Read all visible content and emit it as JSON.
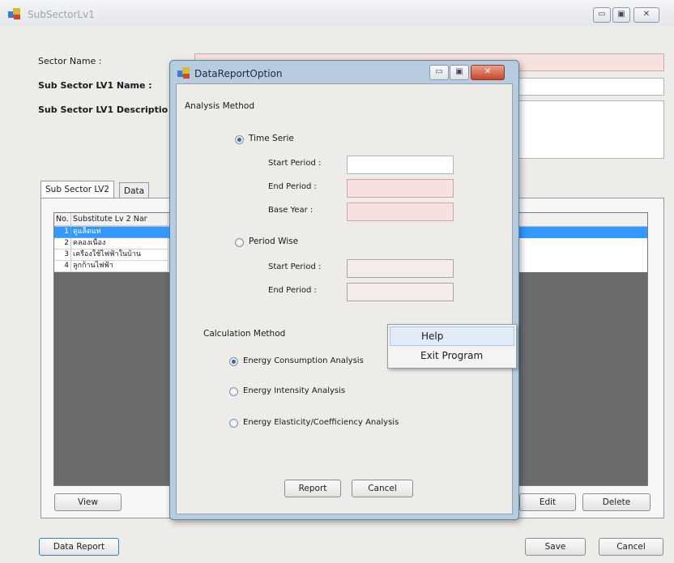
{
  "main_window": {
    "title": "SubSectorLv1",
    "controls": {
      "minimize": "▭",
      "maximize": "▣",
      "close": "✕"
    },
    "form": {
      "sector_name_label": "Sector Name :",
      "sub_sector_name_label": "Sub Sector LV1 Name :",
      "sub_sector_description_label": "Sub Sector LV1 Descriptio"
    },
    "tabs": [
      {
        "label": "Sub Sector LV2"
      },
      {
        "label": "Data"
      }
    ],
    "grid": {
      "headers": [
        "No.",
        "Substitute Lv 2 Nar"
      ],
      "rows": [
        {
          "no": "1",
          "name": "ดูแล็ดแท่"
        },
        {
          "no": "2",
          "name": "คลองเนื้อง"
        },
        {
          "no": "3",
          "name": "เครื่องใช้ไฟฟ้าในบ้าน"
        },
        {
          "no": "4",
          "name": "ลูกก้านไฟฟ้า"
        }
      ]
    },
    "buttons": {
      "view": "View",
      "edit": "Edit",
      "delete": "Delete",
      "data_report": "Data Report",
      "save": "Save",
      "cancel": "Cancel"
    }
  },
  "dialog": {
    "title": "DataReportOption",
    "controls": {
      "minimize": "▭",
      "maximize": "▣",
      "close": "✕"
    },
    "analysis_method": {
      "label": "Analysis Method",
      "time_serie": {
        "label": "Time Serie",
        "selected": true,
        "start_period_label": "Start Period :",
        "end_period_label": "End Period :",
        "base_year_label": "Base Year :"
      },
      "period_wise": {
        "label": "Period Wise",
        "selected": false,
        "start_period_label": "Start Period :",
        "end_period_label": "End Period :"
      }
    },
    "calculation_method": {
      "label": "Calculation Method",
      "options": [
        {
          "label": "Energy Consumption Analysis",
          "selected": true
        },
        {
          "label": "Energy Intensity Analysis",
          "selected": false
        },
        {
          "label": "Energy Elasticity/Coefficiency Analysis",
          "selected": false
        }
      ]
    },
    "buttons": {
      "report": "Report",
      "cancel": "Cancel"
    }
  },
  "context_menu": {
    "items": [
      {
        "label": "Help"
      },
      {
        "label": "Exit Program"
      }
    ]
  },
  "colors": {
    "window_background": "#eeece8",
    "selection": "#3399ff",
    "dialog_frame": "#b8ccdf",
    "pink_field": "#f7e1df"
  }
}
